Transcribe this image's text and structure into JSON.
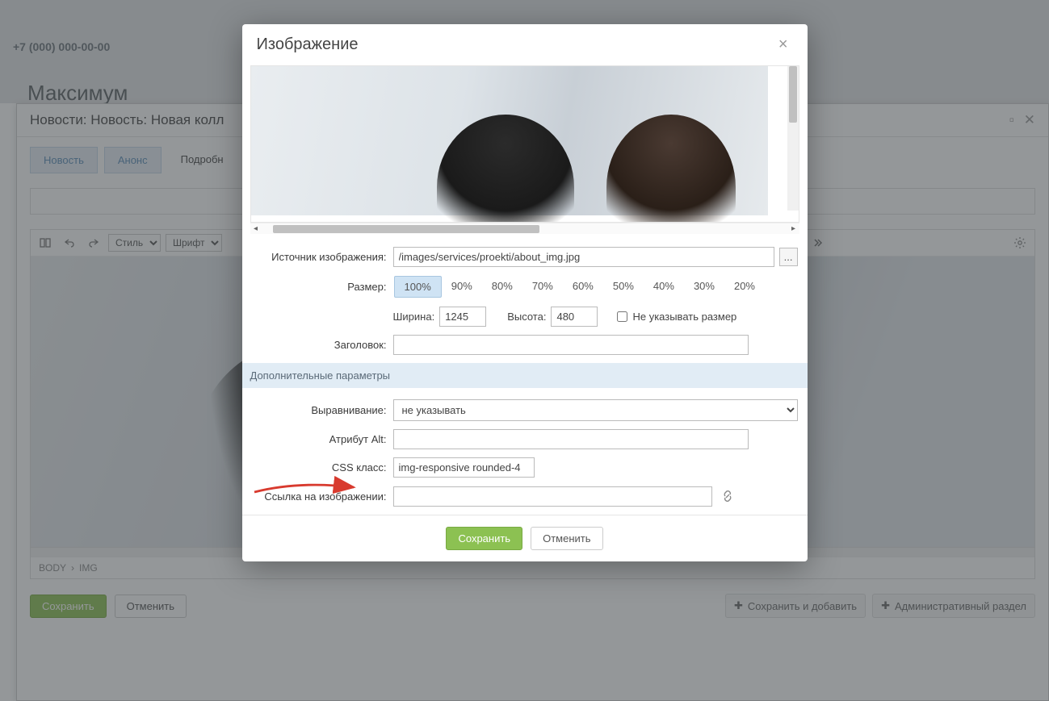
{
  "background": {
    "phone": "+7 (000) 000-00-00",
    "page_title": "Максимум",
    "panel_title": "Новости: Новость: Новая колл",
    "tabs": [
      "Новость",
      "Анонс",
      "Подробн"
    ],
    "toolbar": {
      "style": "Стиль",
      "font": "Шрифт"
    },
    "editor_path": [
      "BODY",
      "IMG"
    ],
    "save": "Сохранить",
    "cancel": "Отменить",
    "save_add": "Сохранить и добавить",
    "admin_section": "Административный раздел"
  },
  "modal": {
    "title": "Изображение",
    "labels": {
      "source": "Источник изображения:",
      "size": "Размер:",
      "width": "Ширина:",
      "height": "Высота:",
      "no_size": "Не указывать размер",
      "header": "Заголовок:",
      "extra": "Дополнительные параметры",
      "align": "Выравнивание:",
      "alt": "Атрибут Alt:",
      "css": "CSS класс:",
      "link": "Ссылка на изображении:"
    },
    "values": {
      "source": "/images/services/proekti/about_img.jpg",
      "width": "1245",
      "height": "480",
      "header": "",
      "align": "не указывать",
      "alt": "",
      "css": "img-responsive rounded-4",
      "link": ""
    },
    "sizes": [
      "100%",
      "90%",
      "80%",
      "70%",
      "60%",
      "50%",
      "40%",
      "30%",
      "20%"
    ],
    "active_size": "100%",
    "browse": "...",
    "save": "Сохранить",
    "cancel": "Отменить"
  }
}
